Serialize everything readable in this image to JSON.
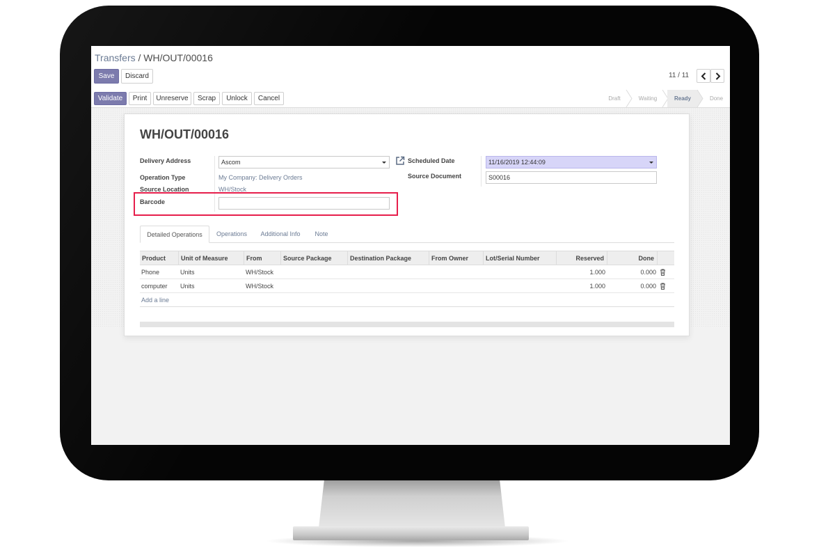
{
  "breadcrumb": {
    "parent": "Transfers",
    "separator": "/",
    "current": "WH/OUT/00016"
  },
  "actions": {
    "save": "Save",
    "discard": "Discard"
  },
  "pager": {
    "value": "11 / 11"
  },
  "statusbar": {
    "buttons": [
      "Validate",
      "Print",
      "Unreserve",
      "Scrap",
      "Unlock",
      "Cancel"
    ],
    "states": [
      "Draft",
      "Waiting",
      "Ready",
      "Done"
    ],
    "active_state": "Ready"
  },
  "record": {
    "title": "WH/OUT/00016",
    "delivery_address_label": "Delivery Address",
    "delivery_address_value": "Ascom",
    "operation_type_label": "Operation Type",
    "operation_type_value": "My Company: Delivery Orders",
    "source_location_label": "Source Location",
    "source_location_value": "WH/Stock",
    "barcode_label": "Barcode",
    "barcode_value": "",
    "scheduled_date_label": "Scheduled Date",
    "scheduled_date_value": "11/16/2019 12:44:09",
    "source_document_label": "Source Document",
    "source_document_value": "S00016"
  },
  "tabs": [
    "Detailed Operations",
    "Operations",
    "Additional Info",
    "Note"
  ],
  "table": {
    "columns": [
      "Product",
      "Unit of Measure",
      "From",
      "Source Package",
      "Destination Package",
      "From Owner",
      "Lot/Serial Number",
      "Reserved",
      "Done"
    ],
    "rows": [
      {
        "product": "Phone",
        "uom": "Units",
        "from": "WH/Stock",
        "reserved": "1.000",
        "done": "0.000"
      },
      {
        "product": "computer",
        "uom": "Units",
        "from": "WH/Stock",
        "reserved": "1.000",
        "done": "0.000"
      }
    ],
    "add_line": "Add a line"
  },
  "colors": {
    "primary": "#7c7bad",
    "link": "#6b7b94",
    "highlight": "#e61e4b",
    "date_field": "#d7d5f8"
  },
  "icons": [
    "chevron-left-icon",
    "chevron-right-icon",
    "external-link-icon",
    "trash-icon",
    "dropdown-caret-icon"
  ]
}
